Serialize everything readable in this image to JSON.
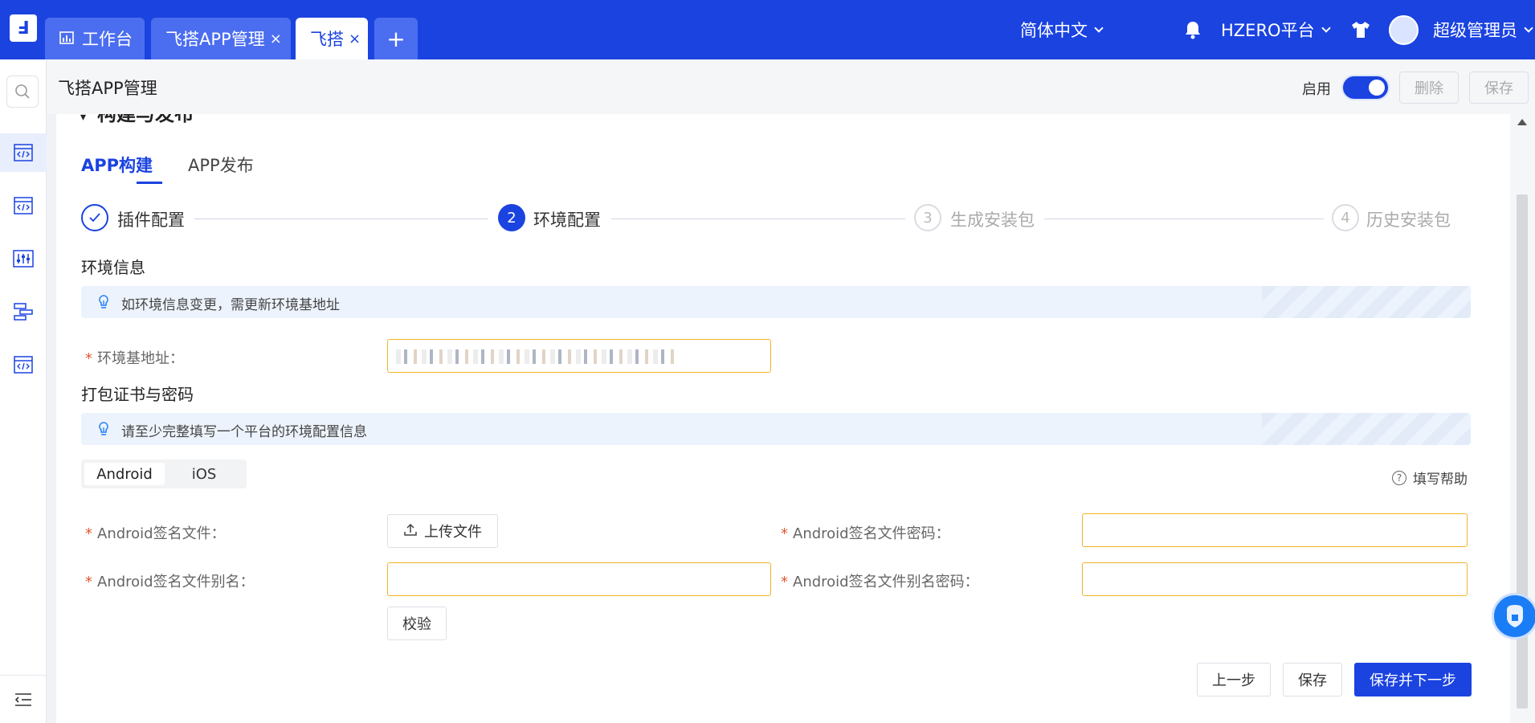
{
  "header": {
    "tabs": [
      {
        "label": "工作台",
        "icon": "dashboard-icon"
      },
      {
        "label": "飞搭APP管理",
        "close": "×"
      },
      {
        "label": "飞搭",
        "close": "×"
      }
    ],
    "add_tab": "+",
    "language": "简体中文",
    "platform": "HZERO平台",
    "user": "超级管理员"
  },
  "sidebar": {
    "icons": [
      "search-icon",
      "code-window-icon",
      "code-window-icon",
      "equalizer-icon",
      "layers-icon",
      "code-window-icon",
      "collapse-menu-icon"
    ]
  },
  "page": {
    "title": "飞搭APP管理",
    "enable_label": "启用",
    "delete_label": "删除",
    "save_label": "保存"
  },
  "section": {
    "title": "构建与发布",
    "tabs": [
      "APP构建",
      "APP发布"
    ]
  },
  "steps": [
    {
      "label": "插件配置",
      "status": "done"
    },
    {
      "label": "环境配置",
      "number": "2",
      "status": "current"
    },
    {
      "label": "生成安装包",
      "number": "3",
      "status": "todo"
    },
    {
      "label": "历史安装包",
      "number": "4",
      "status": "todo"
    }
  ],
  "env_info": {
    "title": "环境信息",
    "notice": "如环境信息变更，需更新环境基地址",
    "base_url_label": "环境基地址："
  },
  "cert": {
    "title": "打包证书与密码",
    "notice": "请至少完整填写一个平台的环境配置信息",
    "platforms": [
      "Android",
      "iOS"
    ],
    "help": "填写帮助",
    "sign_file_label": "Android签名文件：",
    "upload_label": "上传文件",
    "sign_password_label": "Android签名文件密码：",
    "alias_label": "Android签名文件别名：",
    "alias_password_label": "Android签名文件别名密码：",
    "verify_label": "校验"
  },
  "footer": {
    "prev": "上一步",
    "save": "保存",
    "save_next": "保存并下一步"
  },
  "colors": {
    "primary": "#1b43e0",
    "required": "#e4572e",
    "input_border": "#f0b429",
    "notice_bg": "#edf3fc"
  }
}
